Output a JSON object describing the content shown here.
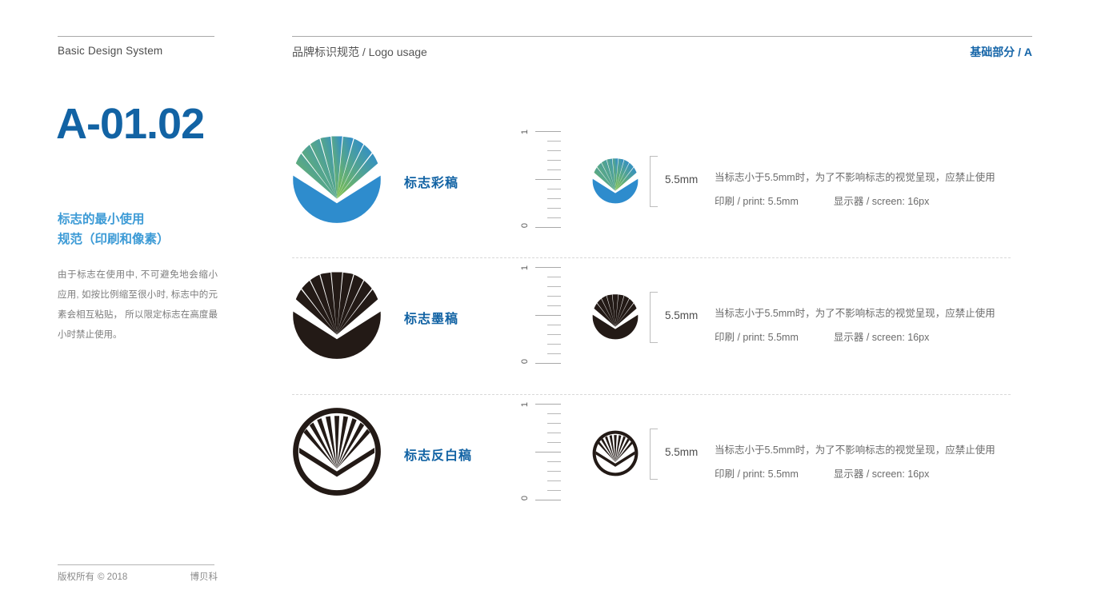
{
  "header": {
    "left_title": "Basic Design System",
    "center_title": "品牌标识规范 / Logo usage",
    "right_title": "基础部分 / A",
    "accent_color": "#1565a8"
  },
  "sidebar": {
    "code": "A-01.02",
    "subtitle_line1": "标志的最小使用",
    "subtitle_line2": "规范（印刷和像素）",
    "body": "由于标志在使用中, 不可避免地会缩小应用, 如按比例缩至很小时, 标志中的元素会相互粘贴， 所以限定标志在高度最小时禁止使用。",
    "subtitle_color": "#3d9bd6",
    "code_color": "#1263a4"
  },
  "footer": {
    "copyright_label": "版权所有",
    "copyright_year": "© 2018",
    "brand": "博贝科"
  },
  "ruler": {
    "top_label": "1",
    "bottom_label": "0",
    "tick_count": 11
  },
  "rows": [
    {
      "label": "标志彩稿",
      "variant": "color",
      "size_label": "5.5mm",
      "note_line1": "当标志小于5.5mm时，为了不影响标志的视觉呈现，应禁止使用",
      "print_label": "印刷 / print: 5.5mm",
      "screen_label": "显示器 / screen: 16px"
    },
    {
      "label": "标志墨稿",
      "variant": "ink",
      "size_label": "5.5mm",
      "note_line1": "当标志小于5.5mm时，为了不影响标志的视觉呈现，应禁止使用",
      "print_label": "印刷 / print: 5.5mm",
      "screen_label": "显示器 / screen: 16px"
    },
    {
      "label": "标志反白稿",
      "variant": "outline",
      "size_label": "5.5mm",
      "note_line1": "当标志小于5.5mm时，为了不影响标志的视觉呈现，应禁止使用",
      "print_label": "印刷 / print: 5.5mm",
      "screen_label": "显示器 / screen: 16px"
    }
  ],
  "colors": {
    "logo_blue": "#2e8ccd",
    "logo_green": "#7ec04a",
    "logo_ink": "#231a16",
    "rule": "#a9a9a9",
    "divider": "#d8d8d8"
  }
}
